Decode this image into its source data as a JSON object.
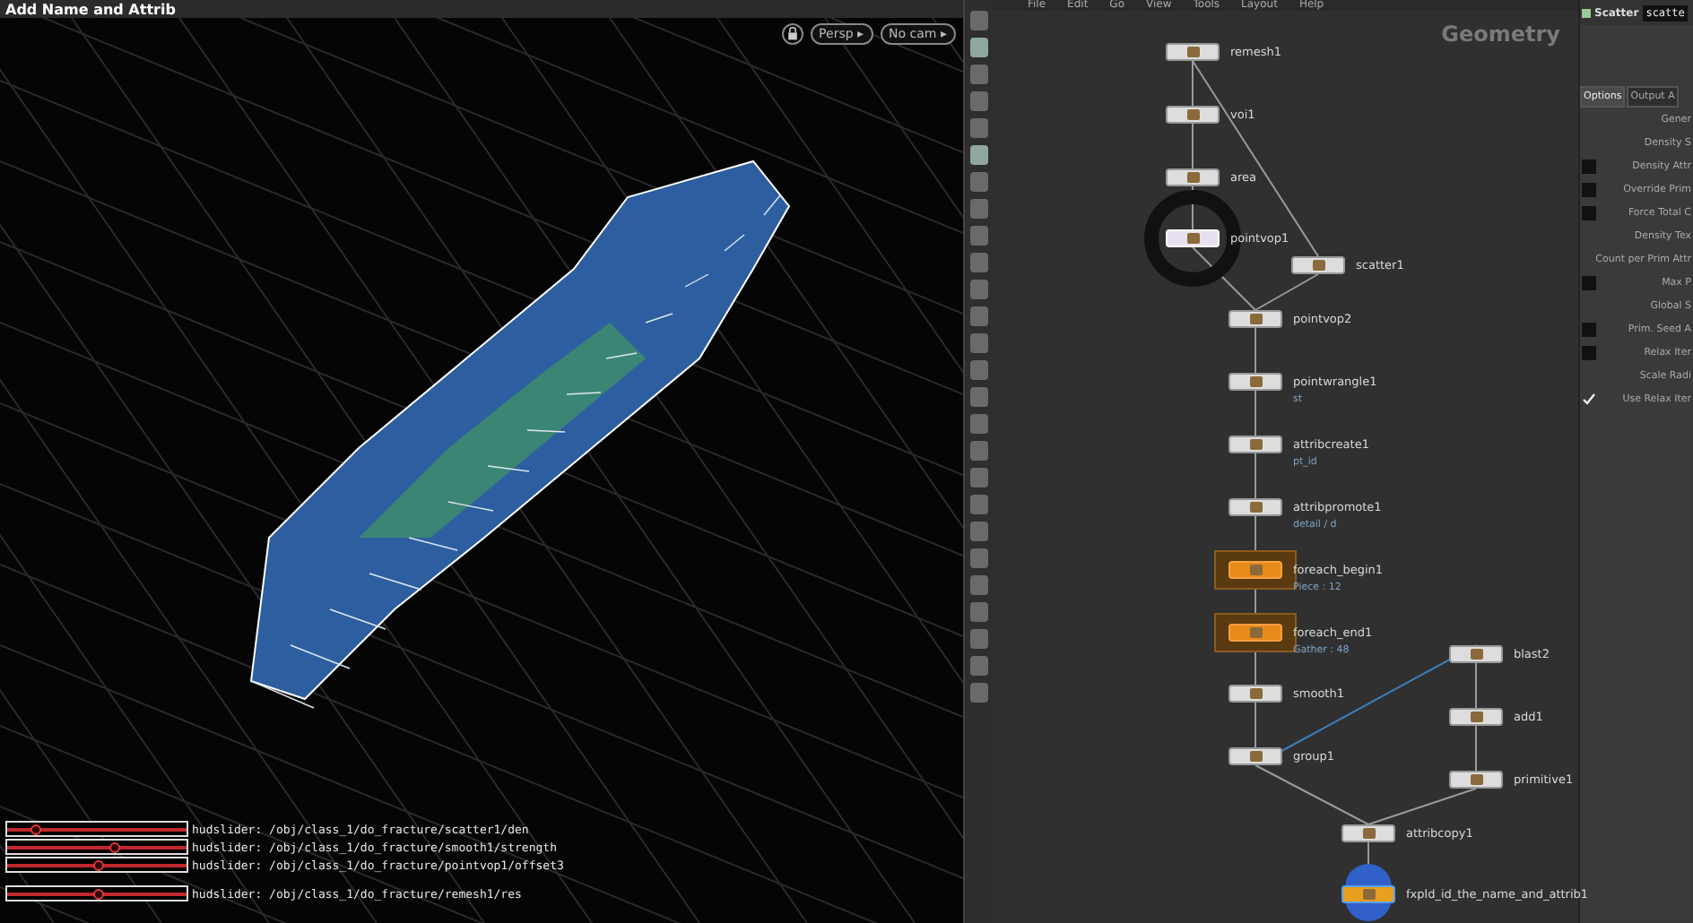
{
  "viewer": {
    "title": "Add Name and Attrib",
    "camera_menus": [
      "Persp ▸",
      "No cam ▸"
    ],
    "hud_sliders": [
      {
        "label": "hudslider: /obj/class_1/do_fracture/scatter1/den",
        "level": 0.16
      },
      {
        "label": "hudslider: /obj/class_1/do_fracture/smooth1/strength",
        "level": 0.6
      },
      {
        "label": "hudslider: /obj/class_1/do_fracture/pointvop1/offset3",
        "level": 0.51
      },
      {
        "label": "hudslider: /obj/class_1/do_fracture/remesh1/res",
        "level": 0.51
      }
    ]
  },
  "network": {
    "menu": [
      "File",
      "Edit",
      "Go",
      "View",
      "Tools",
      "Layout",
      "Help"
    ],
    "context": "Geometry",
    "nodes": [
      {
        "name": "remesh1",
        "kind": "normal"
      },
      {
        "name": "voi1",
        "kind": "normal"
      },
      {
        "name": "area",
        "kind": "normal"
      },
      {
        "name": "pointvop1",
        "kind": "selected"
      },
      {
        "name": "scatter1",
        "kind": "normal"
      },
      {
        "name": "pointvop2",
        "kind": "normal"
      },
      {
        "name": "pointwrangle1",
        "kind": "normal",
        "note": "st"
      },
      {
        "name": "attribcreate1",
        "kind": "normal",
        "note": "pt_id"
      },
      {
        "name": "attribpromote1",
        "kind": "normal",
        "note": "detail / d"
      },
      {
        "name": "foreach_begin1",
        "kind": "block",
        "note": "Piece : 12"
      },
      {
        "name": "foreach_end1",
        "kind": "block",
        "note": "Gather : 48"
      },
      {
        "name": "smooth1",
        "kind": "normal"
      },
      {
        "name": "group1",
        "kind": "normal"
      },
      {
        "name": "blast2",
        "kind": "normal"
      },
      {
        "name": "add1",
        "kind": "normal"
      },
      {
        "name": "primitive1",
        "kind": "normal"
      },
      {
        "name": "attribcopy1",
        "kind": "normal"
      },
      {
        "name": "fxpld_id_the_name_and_attrib1",
        "kind": "output"
      }
    ]
  },
  "parameters": {
    "node_type": "Scatter",
    "node_name": "scatte",
    "tabs": [
      {
        "label": "Options",
        "selected": true
      },
      {
        "label": "Output A",
        "selected": false
      }
    ],
    "rows": [
      {
        "label": "Gener",
        "checked": null
      },
      {
        "label": "Density S",
        "checked": null
      },
      {
        "label": "Density Attr",
        "checked": false
      },
      {
        "label": "Override Prim",
        "checked": false
      },
      {
        "label": "Force Total C",
        "checked": false
      },
      {
        "label": "Density Tex",
        "checked": null
      },
      {
        "label": "Count per Prim Attr",
        "checked": null
      },
      {
        "label": "Max P",
        "checked": false
      },
      {
        "label": "Global S",
        "checked": null
      },
      {
        "label": "Prim. Seed A",
        "checked": false
      },
      {
        "label": "Relax Iter",
        "checked": false
      },
      {
        "label": "Scale Radi",
        "checked": null
      },
      {
        "label": "Use Relax Iter",
        "checked": true
      }
    ]
  }
}
